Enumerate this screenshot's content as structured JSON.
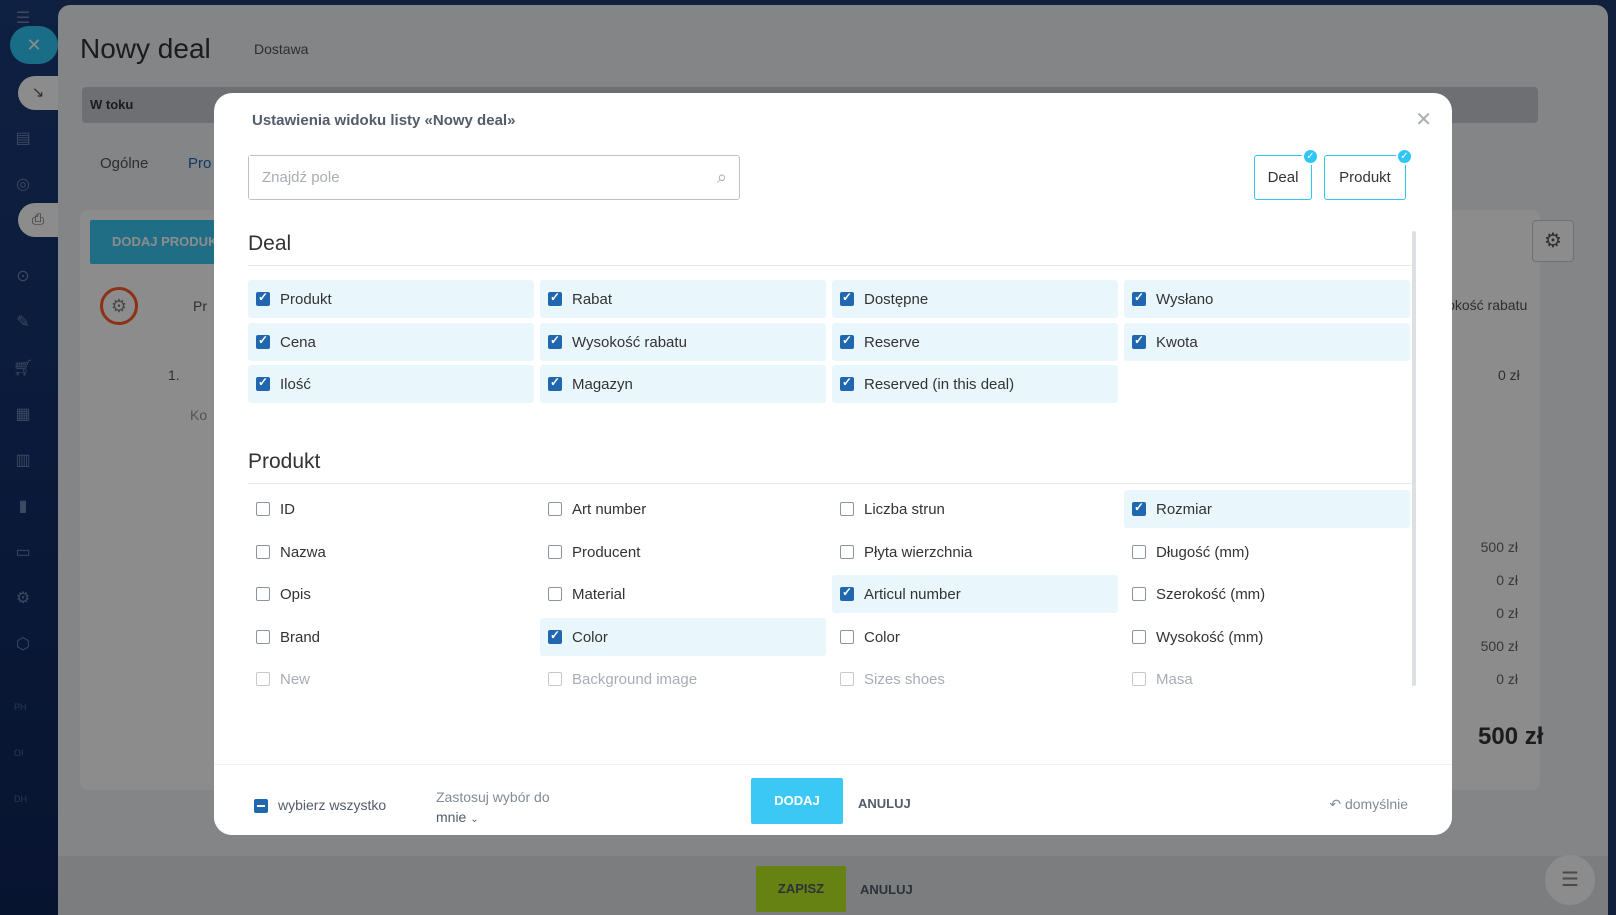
{
  "page": {
    "title": "Nowy deal",
    "subtitle": "Dostawa",
    "stage": "W toku",
    "tabs": [
      "Ogólne",
      "Pro"
    ],
    "add_product": "DODAJ PRODUK",
    "col_header_left": "Pr",
    "col_header_right": "Wysokość rabatu",
    "row_num": "1.",
    "row_price": "0  zł",
    "row_sub": "Ko",
    "sums": [
      "500 zł",
      "0 zł",
      "0 zł",
      "500 zł",
      "0 zł"
    ],
    "total": "500 zł",
    "save": "ZAPISZ",
    "cancel": "ANULUJ"
  },
  "rail": {
    "labels": [
      "PH",
      "OI",
      "DH"
    ]
  },
  "modal": {
    "title": "Ustawienia widoku listy «Nowy deal»",
    "search_placeholder": "Znajdź pole",
    "filters": [
      "Deal",
      "Produkt"
    ],
    "sections": [
      {
        "title": "Deal",
        "items": [
          {
            "label": "Produkt",
            "checked": true
          },
          {
            "label": "Rabat",
            "checked": true
          },
          {
            "label": "Dostępne",
            "checked": true
          },
          {
            "label": "Wysłano",
            "checked": true
          },
          {
            "label": "Cena",
            "checked": true
          },
          {
            "label": "Wysokość rabatu",
            "checked": true
          },
          {
            "label": "Reserve",
            "checked": true
          },
          {
            "label": "Kwota",
            "checked": true
          },
          {
            "label": "Ilość",
            "checked": true
          },
          {
            "label": "Magazyn",
            "checked": true
          },
          {
            "label": "Reserved (in this deal)",
            "checked": true
          }
        ]
      },
      {
        "title": "Produkt",
        "items": [
          {
            "label": "ID",
            "checked": false
          },
          {
            "label": "Art number",
            "checked": false
          },
          {
            "label": "Liczba strun",
            "checked": false
          },
          {
            "label": "Rozmiar",
            "checked": true
          },
          {
            "label": "Nazwa",
            "checked": false
          },
          {
            "label": "Producent",
            "checked": false
          },
          {
            "label": "Płyta wierzchnia",
            "checked": false
          },
          {
            "label": "Długość (mm)",
            "checked": false
          },
          {
            "label": "Opis",
            "checked": false
          },
          {
            "label": "Material",
            "checked": false
          },
          {
            "label": "Articul number",
            "checked": true
          },
          {
            "label": "Szerokość (mm)",
            "checked": false
          },
          {
            "label": "Brand",
            "checked": false
          },
          {
            "label": "Color",
            "checked": true
          },
          {
            "label": "Color",
            "checked": false
          },
          {
            "label": "Wysokość (mm)",
            "checked": false
          },
          {
            "label": "New",
            "checked": false
          },
          {
            "label": "Background image",
            "checked": false
          },
          {
            "label": "Sizes shoes",
            "checked": false
          },
          {
            "label": "Masa",
            "checked": false
          }
        ]
      }
    ],
    "footer": {
      "select_all": "wybierz wszystko",
      "apply_line1": "Zastosuj wybór do",
      "apply_line2": "mnie",
      "add": "DODAJ",
      "cancel": "ANULUJ",
      "default": "domyślnie"
    }
  },
  "colors": {
    "accent": "#2fc6f6",
    "checkbox": "#2067b0",
    "save": "#bbed21",
    "highlight": "#ff5a28"
  }
}
